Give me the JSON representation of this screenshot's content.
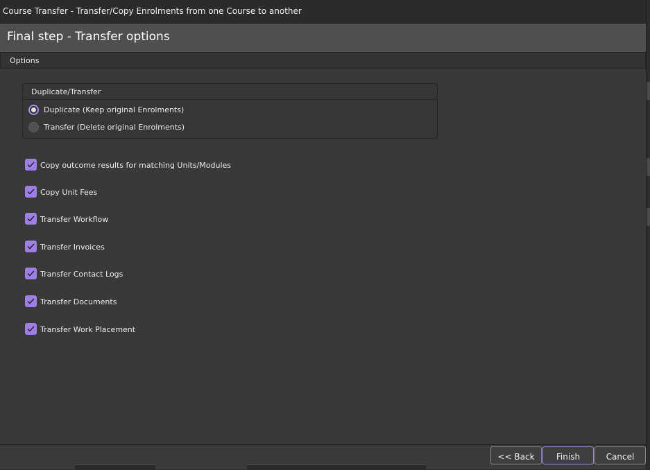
{
  "window": {
    "title": "Course Transfer  - Transfer/Copy Enrolments from one Course to another"
  },
  "step": {
    "title": "Final step - Transfer options"
  },
  "options_bar": {
    "label": "Options"
  },
  "duplicate_transfer": {
    "title": "Duplicate/Transfer",
    "options": [
      {
        "label": "Duplicate (Keep original Enrolments)",
        "selected": true
      },
      {
        "label": "Transfer (Delete original Enrolments)",
        "selected": false
      }
    ]
  },
  "checkboxes": [
    {
      "label": "Copy outcome results for matching Units/Modules",
      "checked": true
    },
    {
      "label": "Copy Unit Fees",
      "checked": true
    },
    {
      "label": "Transfer Workflow",
      "checked": true
    },
    {
      "label": "Transfer Invoices",
      "checked": true
    },
    {
      "label": "Transfer Contact Logs",
      "checked": true
    },
    {
      "label": "Transfer Documents",
      "checked": true
    },
    {
      "label": "Transfer Work Placement",
      "checked": true
    }
  ],
  "buttons": {
    "back": "<< Back",
    "finish": "Finish",
    "cancel": "Cancel"
  },
  "colors": {
    "accent": "#9e7fe6",
    "background": "#393939",
    "header": "#4f4f4f"
  }
}
